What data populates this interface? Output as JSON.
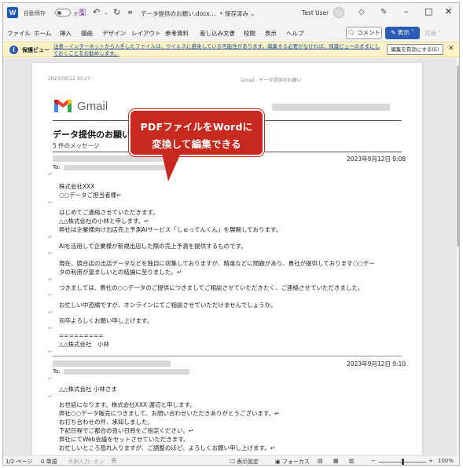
{
  "titlebar": {
    "app_logo": "W",
    "autosave_label": "自動保存",
    "autosave_state": "オフ",
    "doc_title": "データ提供のお願い.docx…",
    "save_status": "• 保存済み",
    "user_name": "Test User"
  },
  "menu": {
    "items": [
      "ファイル",
      "ホーム",
      "挿入",
      "描画",
      "デザイン",
      "レイアウト",
      "参考資料",
      "差し込み文書",
      "校閲",
      "表示",
      "ヘルプ"
    ],
    "comment_label": "コメント",
    "display_label": "表示 ˅",
    "share_label": "共有 ˅"
  },
  "protected_view": {
    "title": "保護ビュー",
    "message": "注意—インターネットから入手したファイルは、ウイルスに感染している可能性があります。編集する必要がなければ、保護ビューのままにしておくことをお勧めします。",
    "enable_button": "編集を有効にする(E)"
  },
  "callout": {
    "line1": "PDFファイルをWordに",
    "line2": "変換して編集できる",
    "color": "#c8281e"
  },
  "document": {
    "meta_date": "2023/09/12 10:27",
    "meta_right": "Gmail - データ提供のお願い",
    "gmail_text": "Gmail",
    "subject": "データ提供のお願い",
    "message_count": "5 件のメッセージ",
    "mail1": {
      "date": "2023年9月12日 9:08",
      "to": "To:",
      "paragraphs": [
        "株式会社XXX",
        "○○データご担当者様↵",
        "はじめてご連絡させていただきます。",
        "△△株式会社の小林と申します。↵",
        "弊社は企業様向け出店売上予測AIサービス「しゅってんくん」を展開しております。",
        "AIを活用して企業様が新規出店した際の売上予測を提供するものです。",
        "現在、競合店の出店データなどを独自に収集しておりますが、精度などに問題があり、貴社が提供しております○○デー",
        "タの利用が望ましいとの結論に至りました。↵",
        "つきましては、貴社の○○データのご提供につきましてご相談させていただきたく、ご連絡させていただきました。",
        "お忙しい中恐縮ですが、オンラインにてご相談させていただけませんでしょうか。",
        "何卒よろしくお願い申し上げます。",
        "=========",
        "△△株式会社　小林"
      ]
    },
    "mail2": {
      "date": "2023年9月12日 9:10",
      "to": "To:",
      "paragraphs": [
        "△△株式会社 小林さま",
        "お世話になります。株式会社XXX 渡辺と申します。",
        "弊社○○データ販売につきまして、お問い合わせいただきありがとうございます。↵",
        "お打ち合わせの件、承知しました。",
        "下記日程でご都合の良い日時をご指定ください。↵",
        "弊社にてWeb会議をセットさせていただきます。",
        "お忙しいところ恐れ入りますが、ご調整のほど、よろしくお願い申し上げます。↵"
      ]
    }
  },
  "statusbar": {
    "page": "1/2 ページ",
    "words": "0 単語",
    "predict": "予測入力: オン",
    "display_settings": "表示設定",
    "focus": "フォーカス",
    "zoom": "100%"
  }
}
